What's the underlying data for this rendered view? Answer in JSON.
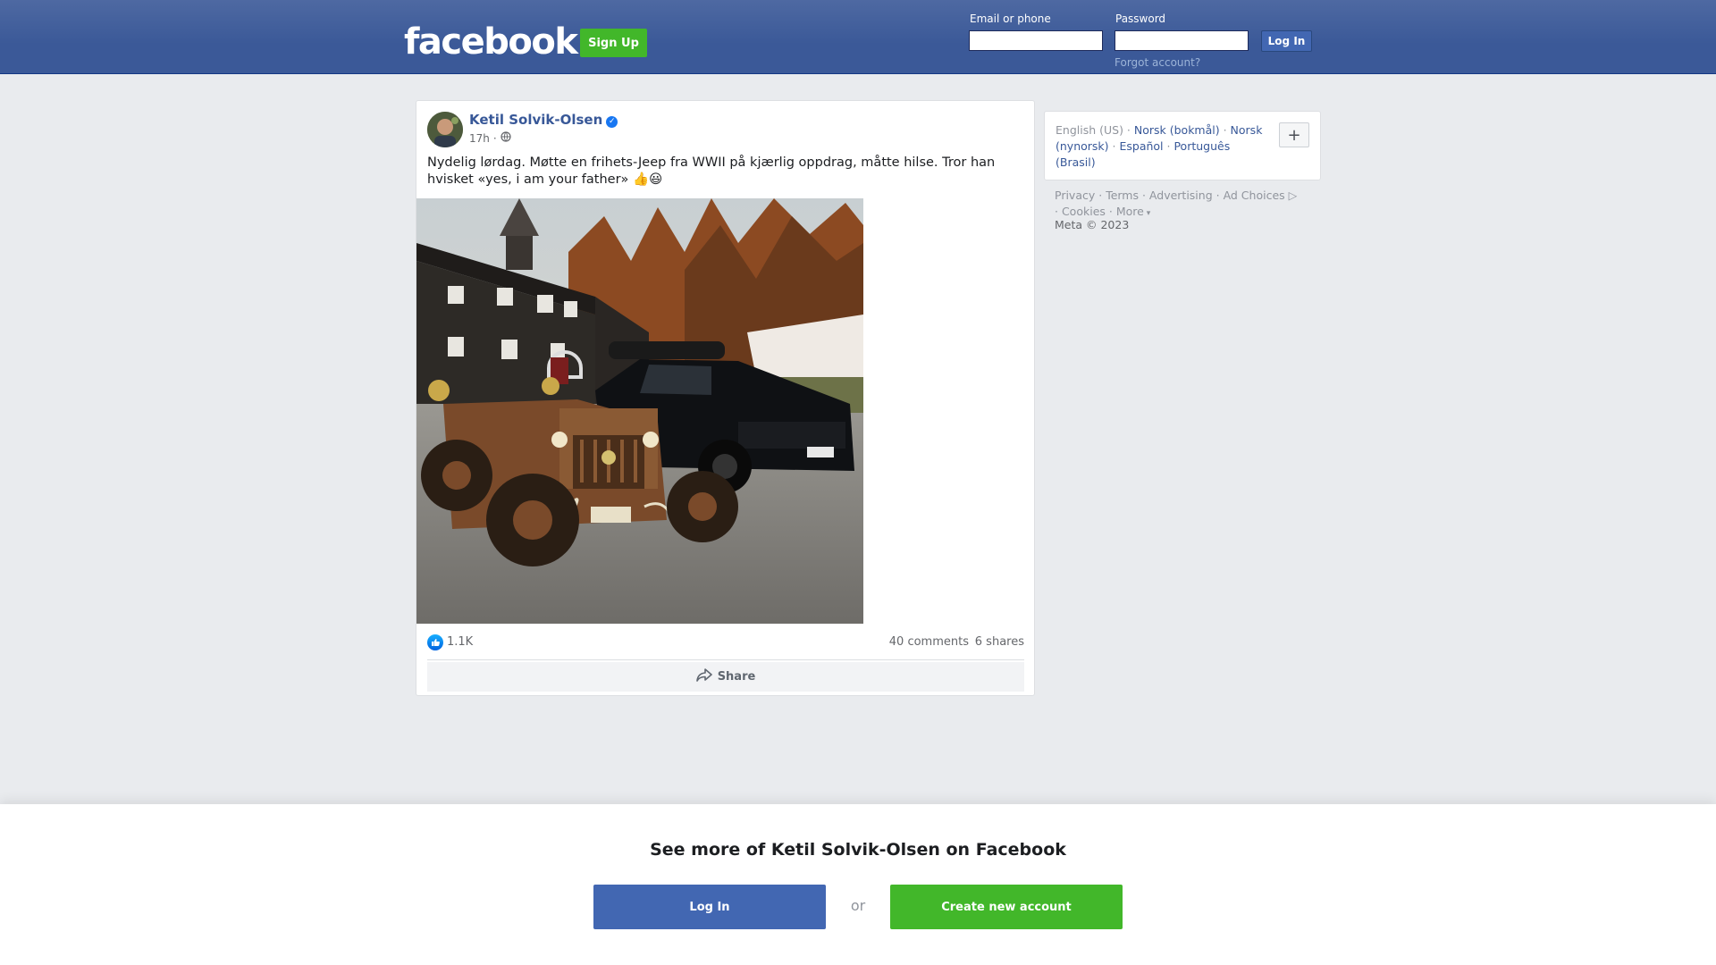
{
  "header": {
    "logo": "facebook",
    "signup_label": "Sign Up",
    "email_label": "Email or phone",
    "email_value": "",
    "password_label": "Password",
    "password_value": "",
    "login_label": "Log In",
    "forgot_label": "Forgot account?"
  },
  "post": {
    "author": "Ketil Solvik-Olsen",
    "verified_icon": "verified-badge-icon",
    "time": "17h",
    "separator": "·",
    "audience_icon": "globe-icon",
    "text": "Nydelig lørdag. Møtte en frihets-Jeep fra WWII på kjærlig oppdrag, måtte hilse. Tror han hvisket «yes, i am your father» 👍😃",
    "reactions_count": "1.1K",
    "comments": "40 comments",
    "shares": "6 shares",
    "share_label": "Share"
  },
  "languages": {
    "current": "English (US)",
    "items": [
      "Norsk (bokmål)",
      "Norsk (nynorsk)",
      "Español",
      "Português (Brasil)"
    ],
    "more_label": "+"
  },
  "footer": {
    "links": [
      "Privacy",
      "Terms",
      "Advertising",
      "Ad Choices",
      "Cookies",
      "More"
    ],
    "copyright": "Meta © 2023"
  },
  "banner": {
    "title": "See more of Ketil Solvik-Olsen on Facebook",
    "login_label": "Log In",
    "or_label": "or",
    "create_label": "Create new account"
  },
  "colors": {
    "brand_blue": "#3b5998",
    "green": "#42b72a",
    "link": "#385898"
  }
}
